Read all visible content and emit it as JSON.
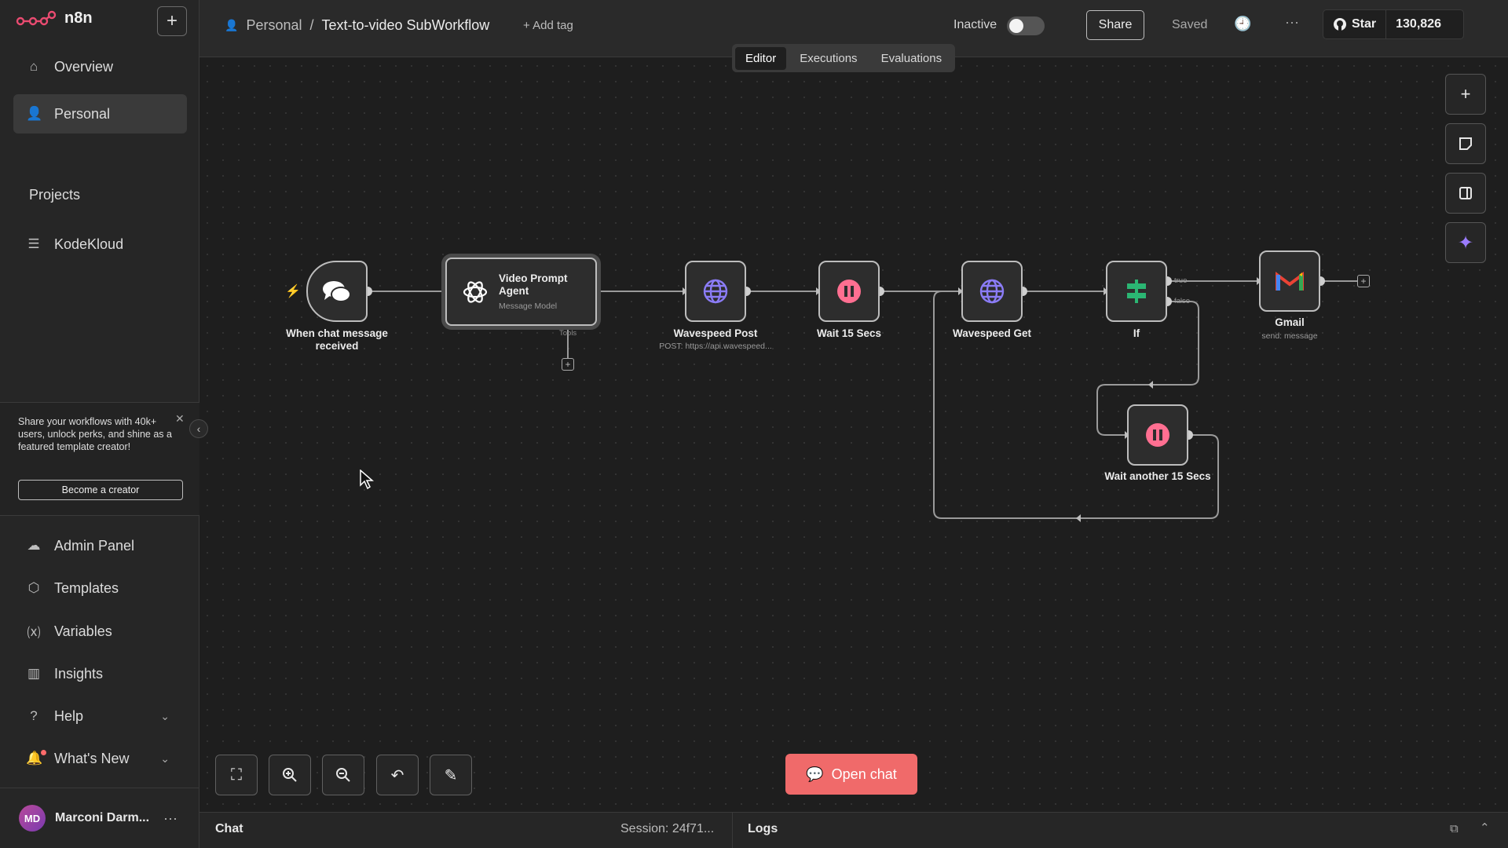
{
  "app": {
    "name": "n8n"
  },
  "sidebar": {
    "nav_top": [
      {
        "label": "Overview",
        "icon": "home-icon"
      },
      {
        "label": "Personal",
        "icon": "user-icon"
      }
    ],
    "projects_title": "Projects",
    "projects": [
      {
        "label": "KodeKloud",
        "icon": "layers-icon"
      }
    ],
    "promo": {
      "text": "Share your workflows with 40k+ users, unlock perks, and shine as a featured template creator!",
      "button": "Become a creator"
    },
    "nav_bottom": [
      {
        "label": "Admin Panel",
        "icon": "cloud-icon"
      },
      {
        "label": "Templates",
        "icon": "box-icon"
      },
      {
        "label": "Variables",
        "icon": "variable-icon"
      },
      {
        "label": "Insights",
        "icon": "chart-icon"
      },
      {
        "label": "Help",
        "icon": "help-icon"
      },
      {
        "label": "What's New",
        "icon": "bell-icon"
      }
    ],
    "user": {
      "initials": "MD",
      "name": "Marconi Darm..."
    }
  },
  "topbar": {
    "breadcrumb_project": "Personal",
    "workflow_name": "Text-to-video SubWorkflow",
    "add_tag": "+ Add tag",
    "status_label": "Inactive",
    "share": "Share",
    "saved": "Saved",
    "github_star": "Star",
    "github_count": "130,826"
  },
  "tabs": [
    {
      "label": "Editor",
      "active": true
    },
    {
      "label": "Executions",
      "active": false
    },
    {
      "label": "Evaluations",
      "active": false
    }
  ],
  "nodes": {
    "trigger": {
      "label": "When chat message received"
    },
    "agent": {
      "label": "Video Prompt Agent",
      "sub": "Message Model",
      "tools": "Tools"
    },
    "wavespeed_post": {
      "label": "Wavespeed Post",
      "sub": "POST: https://api.wavespeed..."
    },
    "wait1": {
      "label": "Wait 15 Secs"
    },
    "wavespeed_get": {
      "label": "Wavespeed Get"
    },
    "if": {
      "label": "If",
      "true": "true",
      "false": "false"
    },
    "gmail": {
      "label": "Gmail",
      "sub": "send: message"
    },
    "wait2": {
      "label": "Wait another 15 Secs"
    }
  },
  "canvas_controls": {
    "open_chat": "Open chat"
  },
  "bottom_panel": {
    "chat": "Chat",
    "session": "Session: 24f71...",
    "logs": "Logs"
  },
  "colors": {
    "accent": "#f06a6a",
    "wait": "#ff6f91",
    "http": "#8b7cf6",
    "if": "#2bb673"
  }
}
